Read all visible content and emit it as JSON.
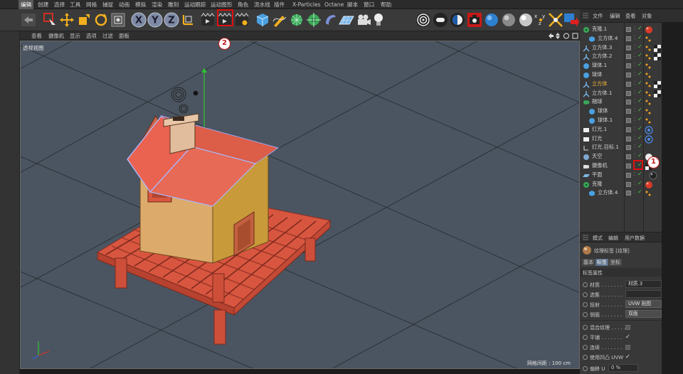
{
  "menubar": {
    "items": [
      "编辑",
      "创建",
      "选择",
      "工具",
      "网格",
      "捕捉",
      "动画",
      "模拟",
      "渲染",
      "雕刻",
      "运动跟踪",
      "运动图形",
      "角色",
      "流水线",
      "插件",
      "X-Particles",
      "Octane",
      "脚本",
      "窗口",
      "帮助"
    ]
  },
  "viewport": {
    "menu": [
      "查看",
      "摄像机",
      "显示",
      "选项",
      "过滤",
      "面板"
    ],
    "label": "透视视图",
    "grid_status": "网格间距 : 100 cm"
  },
  "object_manager": {
    "tabs": [
      "文件",
      "编辑",
      "查看",
      "对象"
    ],
    "objects": [
      {
        "name": "克隆.1",
        "icon": "cloner-icon",
        "indent": 0,
        "tag": "red-sphere"
      },
      {
        "name": "立方体.4",
        "icon": "cube-icon",
        "indent": 1,
        "tag": "dots"
      },
      {
        "name": "立方体.3",
        "icon": "joint-icon",
        "indent": 0,
        "tag": "dots-checker"
      },
      {
        "name": "立方体.2",
        "icon": "joint-icon",
        "indent": 0,
        "tag": "dots-checker"
      },
      {
        "name": "球体.1",
        "icon": "sphere-icon",
        "indent": 0,
        "tag": "dots"
      },
      {
        "name": "球体",
        "icon": "sphere-icon",
        "indent": 0,
        "tag": "dots"
      },
      {
        "name": "立方体",
        "icon": "joint-icon",
        "indent": 0,
        "tag": "dots-checker",
        "selected": true
      },
      {
        "name": "立方体.1",
        "icon": "joint-icon",
        "indent": 0,
        "tag": "dots-checker"
      },
      {
        "name": "融球",
        "icon": "metaball-icon",
        "indent": 0,
        "tag": "dots"
      },
      {
        "name": "球体",
        "icon": "sphere-icon",
        "indent": 1,
        "tag": "dots"
      },
      {
        "name": "球体.1",
        "icon": "sphere-icon",
        "indent": 1,
        "tag": "dots"
      },
      {
        "name": "灯光.1",
        "icon": "light-icon",
        "indent": 0,
        "tag": "target"
      },
      {
        "name": "灯光",
        "icon": "light-icon",
        "indent": 0,
        "tag": "target"
      },
      {
        "name": "灯光.目标.1",
        "icon": "null-icon",
        "indent": 0,
        "tag": ""
      },
      {
        "name": "天空",
        "icon": "sky-icon",
        "indent": 0,
        "tag": "white-sphere"
      },
      {
        "name": "摄像机",
        "icon": "camera-icon",
        "indent": 0,
        "tag": "checker-highlight"
      },
      {
        "name": "平面",
        "icon": "plane-icon",
        "indent": 0,
        "tag": "dark-sphere"
      },
      {
        "name": "克隆",
        "icon": "cloner-icon",
        "indent": 0,
        "tag": "red-sphere"
      },
      {
        "name": "立方体.4",
        "icon": "cube-icon",
        "indent": 1,
        "tag": "dots"
      }
    ]
  },
  "attributes": {
    "tabs": [
      "模式",
      "编辑",
      "用户数据"
    ],
    "title": "纹理标签 [纹理]",
    "subtabs": [
      "基本",
      "标签",
      "坐标"
    ],
    "active_subtab": "标签",
    "section": "标签属性",
    "props": {
      "material": {
        "label": "材质 . . . . . . .",
        "value": "材质.3"
      },
      "selection": {
        "label": "选集 . . . . . . ."
      },
      "projection": {
        "label": "投射 . . . . . . .",
        "value": "UVW 贴图"
      },
      "side": {
        "label": "侧面 . . . . . . .",
        "value": "双面"
      },
      "blend": {
        "label": "混合纹理 . . . . ."
      },
      "tile": {
        "label": "平铺 . . . . . . .",
        "checked": true
      },
      "seamless": {
        "label": "连续 . . . . . . ."
      },
      "bump_uvw": {
        "label": "使用凹凸 UVW",
        "checked": true
      },
      "offset": {
        "label": "偏移 U",
        "value": "0 %"
      }
    }
  },
  "annotations": {
    "callout_1": "1",
    "callout_2": "2"
  },
  "colors": {
    "callout_red": "#e01010",
    "selected_orange": "#f2b43a",
    "viewport_bg": "#4b5561",
    "roof_red": "#ea6250",
    "wall_tan": "#dcaa6a"
  }
}
